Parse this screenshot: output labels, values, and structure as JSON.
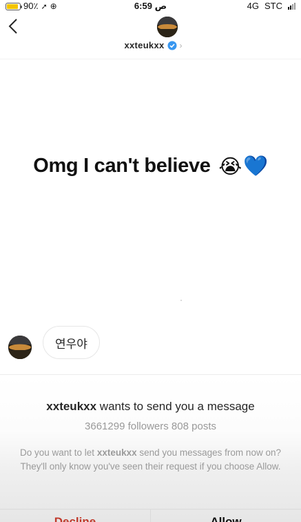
{
  "status_bar": {
    "battery": "90٪",
    "battery_level": 0.9,
    "time": "6:59 ص",
    "network": "4G",
    "carrier": "STC"
  },
  "header": {
    "username": "xxteukxx",
    "verified": true
  },
  "conversation": {
    "big_message": "Omg I can't believe",
    "emoji": [
      "😭",
      "💙"
    ],
    "bubble_text": "연우야"
  },
  "request": {
    "title_username": "xxteukxx",
    "title_suffix": " wants to send you a message",
    "stats": "3661299 followers 808 posts",
    "body_prefix": "Do you want to let ",
    "body_username": "xxteukxx",
    "body_suffix": " send you messages from now on? They'll only know you've seen their request if you choose Allow.",
    "decline_label": "Decline",
    "allow_label": "Allow"
  },
  "colors": {
    "verified_blue": "#3897f0",
    "decline_red": "#c0392b",
    "battery_yellow": "#f5c400"
  }
}
